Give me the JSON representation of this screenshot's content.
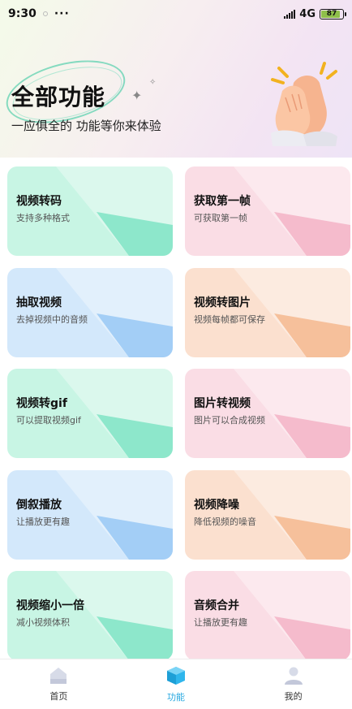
{
  "status_bar": {
    "time": "9:30",
    "more": "···",
    "network": "4G",
    "battery": "87",
    "battery_level": 0.87
  },
  "hero": {
    "title": "全部功能",
    "subtitle": "一应俱全的 功能等你来体验"
  },
  "cards": [
    {
      "title": "视频转码",
      "desc": "支持多种格式",
      "theme": "green"
    },
    {
      "title": "获取第一帧",
      "desc": "可获取第一帧",
      "theme": "pink"
    },
    {
      "title": "抽取视频",
      "desc": "去掉视频中的音频",
      "theme": "blue"
    },
    {
      "title": "视频转图片",
      "desc": "视频每帧都可保存",
      "theme": "peach"
    },
    {
      "title": "视频转gif",
      "desc": "可以提取视频gif",
      "theme": "green"
    },
    {
      "title": "图片转视频",
      "desc": "图片可以合成视频",
      "theme": "pink"
    },
    {
      "title": "倒叙播放",
      "desc": "让播放更有趣",
      "theme": "blue"
    },
    {
      "title": "视频降噪",
      "desc": "降低视频的噪音",
      "theme": "peach"
    },
    {
      "title": "视频缩小一倍",
      "desc": "减小视频体积",
      "theme": "green"
    },
    {
      "title": "音频合并",
      "desc": "让播放更有趣",
      "theme": "pink"
    }
  ],
  "theme_colors": {
    "green": "#7fe4c4",
    "pink": "#f3b3c6",
    "blue": "#98c8f4",
    "peach": "#f4b98e",
    "accent": "#26a8e0"
  },
  "bottom_nav": {
    "items": [
      {
        "label": "首页",
        "icon": "home-icon",
        "active": false
      },
      {
        "label": "功能",
        "icon": "cube-icon",
        "active": true
      },
      {
        "label": "我的",
        "icon": "user-icon",
        "active": false
      }
    ]
  }
}
